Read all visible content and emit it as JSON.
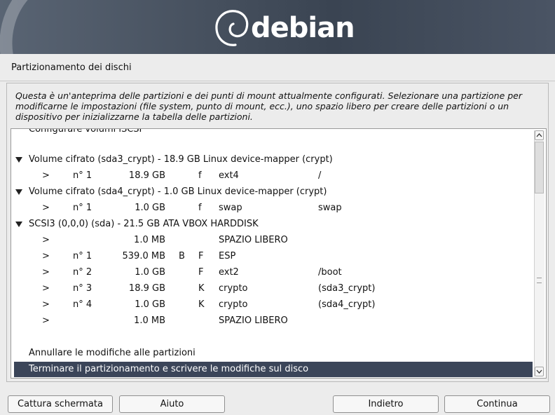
{
  "banner": {
    "logo_text": "debian"
  },
  "page_title": "Partizionamento dei dischi",
  "description": "Questa è un'anteprima delle partizioni e dei punti di mount attualmente configurati. Selezionare una partizione per modificarne le impostazioni (file system, punto di mount, ecc.), uno spazio libero per creare delle partizioni o un dispositivo per inizializzarne la tabella delle partizioni.",
  "partition_list": {
    "partial_top_item": "Configurare volumi iSCSI",
    "devices": [
      {
        "label": "Volume cifrato (sda3_crypt) - 18.9 GB Linux device-mapper (crypt)",
        "partitions": [
          {
            "arrow": ">",
            "num": "n° 1",
            "size": "18.9 GB",
            "flag1": "",
            "flag2": "f",
            "fs": "ext4",
            "mount": "/"
          }
        ]
      },
      {
        "label": "Volume cifrato (sda4_crypt) - 1.0 GB Linux device-mapper (crypt)",
        "partitions": [
          {
            "arrow": ">",
            "num": "n° 1",
            "size": "1.0 GB",
            "flag1": "",
            "flag2": "f",
            "fs": "swap",
            "mount": "swap"
          }
        ]
      },
      {
        "label": "SCSI3 (0,0,0) (sda) - 21.5 GB ATA VBOX HARDDISK",
        "partitions": [
          {
            "arrow": ">",
            "num": "",
            "size": "1.0 MB",
            "flag1": "",
            "flag2": "",
            "fs": "SPAZIO LIBERO",
            "mount": ""
          },
          {
            "arrow": ">",
            "num": "n° 1",
            "size": "539.0 MB",
            "flag1": "B",
            "flag2": "F",
            "fs": "ESP",
            "mount": ""
          },
          {
            "arrow": ">",
            "num": "n° 2",
            "size": "1.0 GB",
            "flag1": "",
            "flag2": "F",
            "fs": "ext2",
            "mount": "/boot"
          },
          {
            "arrow": ">",
            "num": "n° 3",
            "size": "18.9 GB",
            "flag1": "",
            "flag2": "K",
            "fs": "crypto",
            "mount": "(sda3_crypt)"
          },
          {
            "arrow": ">",
            "num": "n° 4",
            "size": "1.0 GB",
            "flag1": "",
            "flag2": "K",
            "fs": "crypto",
            "mount": "(sda4_crypt)"
          },
          {
            "arrow": ">",
            "num": "",
            "size": "1.0 MB",
            "flag1": "",
            "flag2": "",
            "fs": "SPAZIO LIBERO",
            "mount": ""
          }
        ]
      }
    ],
    "undo_label": "Annullare le modifiche alle partizioni",
    "finish_label": "Terminare il partizionamento e scrivere le modifiche sul disco"
  },
  "buttons": {
    "screenshot": "Cattura schermata",
    "help": "Aiuto",
    "back": "Indietro",
    "continue": "Continua"
  },
  "colors": {
    "selection": "#3b4559",
    "banner": "#454f5d"
  }
}
